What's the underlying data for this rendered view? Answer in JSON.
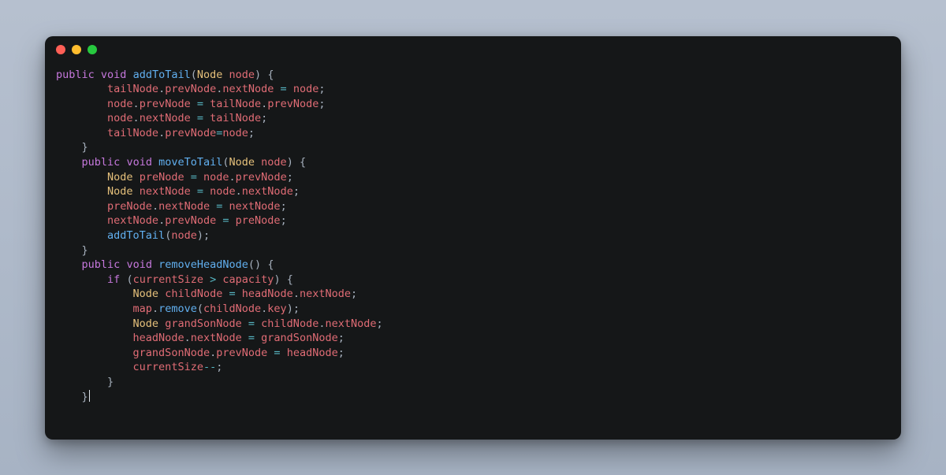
{
  "window": {
    "traffic_lights": [
      "close",
      "minimize",
      "maximize"
    ]
  },
  "code": {
    "language": "java",
    "lines": [
      {
        "indent": 0,
        "tokens": [
          [
            "kw",
            "public"
          ],
          [
            "sp",
            " "
          ],
          [
            "kw",
            "void"
          ],
          [
            "sp",
            " "
          ],
          [
            "fn",
            "addToTail"
          ],
          [
            "punc",
            "("
          ],
          [
            "type",
            "Node"
          ],
          [
            "sp",
            " "
          ],
          [
            "id",
            "node"
          ],
          [
            "punc",
            ")"
          ],
          [
            "sp",
            " "
          ],
          [
            "punc",
            "{"
          ]
        ]
      },
      {
        "indent": 2,
        "tokens": [
          [
            "id",
            "tailNode"
          ],
          [
            "punc",
            "."
          ],
          [
            "id",
            "prevNode"
          ],
          [
            "punc",
            "."
          ],
          [
            "id",
            "nextNode"
          ],
          [
            "sp",
            " "
          ],
          [
            "op",
            "="
          ],
          [
            "sp",
            " "
          ],
          [
            "id",
            "node"
          ],
          [
            "punc",
            ";"
          ]
        ]
      },
      {
        "indent": 2,
        "tokens": [
          [
            "id",
            "node"
          ],
          [
            "punc",
            "."
          ],
          [
            "id",
            "prevNode"
          ],
          [
            "sp",
            " "
          ],
          [
            "op",
            "="
          ],
          [
            "sp",
            " "
          ],
          [
            "id",
            "tailNode"
          ],
          [
            "punc",
            "."
          ],
          [
            "id",
            "prevNode"
          ],
          [
            "punc",
            ";"
          ]
        ]
      },
      {
        "indent": 2,
        "tokens": [
          [
            "id",
            "node"
          ],
          [
            "punc",
            "."
          ],
          [
            "id",
            "nextNode"
          ],
          [
            "sp",
            " "
          ],
          [
            "op",
            "="
          ],
          [
            "sp",
            " "
          ],
          [
            "id",
            "tailNode"
          ],
          [
            "punc",
            ";"
          ]
        ]
      },
      {
        "indent": 2,
        "tokens": [
          [
            "id",
            "tailNode"
          ],
          [
            "punc",
            "."
          ],
          [
            "id",
            "prevNode"
          ],
          [
            "op",
            "="
          ],
          [
            "id",
            "node"
          ],
          [
            "punc",
            ";"
          ]
        ]
      },
      {
        "indent": 1,
        "tokens": [
          [
            "punc",
            "}"
          ]
        ]
      },
      {
        "indent": 1,
        "tokens": [
          [
            "kw",
            "public"
          ],
          [
            "sp",
            " "
          ],
          [
            "kw",
            "void"
          ],
          [
            "sp",
            " "
          ],
          [
            "fn",
            "moveToTail"
          ],
          [
            "punc",
            "("
          ],
          [
            "type",
            "Node"
          ],
          [
            "sp",
            " "
          ],
          [
            "id",
            "node"
          ],
          [
            "punc",
            ")"
          ],
          [
            "sp",
            " "
          ],
          [
            "punc",
            "{"
          ]
        ]
      },
      {
        "indent": 2,
        "tokens": [
          [
            "type",
            "Node"
          ],
          [
            "sp",
            " "
          ],
          [
            "id",
            "preNode"
          ],
          [
            "sp",
            " "
          ],
          [
            "op",
            "="
          ],
          [
            "sp",
            " "
          ],
          [
            "id",
            "node"
          ],
          [
            "punc",
            "."
          ],
          [
            "id",
            "prevNode"
          ],
          [
            "punc",
            ";"
          ]
        ]
      },
      {
        "indent": 2,
        "tokens": [
          [
            "type",
            "Node"
          ],
          [
            "sp",
            " "
          ],
          [
            "id",
            "nextNode"
          ],
          [
            "sp",
            " "
          ],
          [
            "op",
            "="
          ],
          [
            "sp",
            " "
          ],
          [
            "id",
            "node"
          ],
          [
            "punc",
            "."
          ],
          [
            "id",
            "nextNode"
          ],
          [
            "punc",
            ";"
          ]
        ]
      },
      {
        "indent": 2,
        "tokens": [
          [
            "id",
            "preNode"
          ],
          [
            "punc",
            "."
          ],
          [
            "id",
            "nextNode"
          ],
          [
            "sp",
            " "
          ],
          [
            "op",
            "="
          ],
          [
            "sp",
            " "
          ],
          [
            "id",
            "nextNode"
          ],
          [
            "punc",
            ";"
          ]
        ]
      },
      {
        "indent": 2,
        "tokens": [
          [
            "id",
            "nextNode"
          ],
          [
            "punc",
            "."
          ],
          [
            "id",
            "prevNode"
          ],
          [
            "sp",
            " "
          ],
          [
            "op",
            "="
          ],
          [
            "sp",
            " "
          ],
          [
            "id",
            "preNode"
          ],
          [
            "punc",
            ";"
          ]
        ]
      },
      {
        "indent": 2,
        "tokens": [
          [
            "fn",
            "addToTail"
          ],
          [
            "punc",
            "("
          ],
          [
            "id",
            "node"
          ],
          [
            "punc",
            ")"
          ],
          [
            "punc",
            ";"
          ]
        ]
      },
      {
        "indent": 1,
        "tokens": [
          [
            "punc",
            "}"
          ]
        ]
      },
      {
        "indent": 1,
        "tokens": [
          [
            "kw",
            "public"
          ],
          [
            "sp",
            " "
          ],
          [
            "kw",
            "void"
          ],
          [
            "sp",
            " "
          ],
          [
            "fn",
            "removeHeadNode"
          ],
          [
            "punc",
            "("
          ],
          [
            "punc",
            ")"
          ],
          [
            "sp",
            " "
          ],
          [
            "punc",
            "{"
          ]
        ]
      },
      {
        "indent": 2,
        "tokens": [
          [
            "kw",
            "if"
          ],
          [
            "sp",
            " "
          ],
          [
            "punc",
            "("
          ],
          [
            "id",
            "currentSize"
          ],
          [
            "sp",
            " "
          ],
          [
            "op",
            ">"
          ],
          [
            "sp",
            " "
          ],
          [
            "id",
            "capacity"
          ],
          [
            "punc",
            ")"
          ],
          [
            "sp",
            " "
          ],
          [
            "punc",
            "{"
          ]
        ]
      },
      {
        "indent": 3,
        "tokens": [
          [
            "type",
            "Node"
          ],
          [
            "sp",
            " "
          ],
          [
            "id",
            "childNode"
          ],
          [
            "sp",
            " "
          ],
          [
            "op",
            "="
          ],
          [
            "sp",
            " "
          ],
          [
            "id",
            "headNode"
          ],
          [
            "punc",
            "."
          ],
          [
            "id",
            "nextNode"
          ],
          [
            "punc",
            ";"
          ]
        ]
      },
      {
        "indent": 3,
        "tokens": [
          [
            "id",
            "map"
          ],
          [
            "punc",
            "."
          ],
          [
            "fn",
            "remove"
          ],
          [
            "punc",
            "("
          ],
          [
            "id",
            "childNode"
          ],
          [
            "punc",
            "."
          ],
          [
            "id",
            "key"
          ],
          [
            "punc",
            ")"
          ],
          [
            "punc",
            ";"
          ]
        ]
      },
      {
        "indent": 3,
        "tokens": [
          [
            "type",
            "Node"
          ],
          [
            "sp",
            " "
          ],
          [
            "id",
            "grandSonNode"
          ],
          [
            "sp",
            " "
          ],
          [
            "op",
            "="
          ],
          [
            "sp",
            " "
          ],
          [
            "id",
            "childNode"
          ],
          [
            "punc",
            "."
          ],
          [
            "id",
            "nextNode"
          ],
          [
            "punc",
            ";"
          ]
        ]
      },
      {
        "indent": 3,
        "tokens": [
          [
            "id",
            "headNode"
          ],
          [
            "punc",
            "."
          ],
          [
            "id",
            "nextNode"
          ],
          [
            "sp",
            " "
          ],
          [
            "op",
            "="
          ],
          [
            "sp",
            " "
          ],
          [
            "id",
            "grandSonNode"
          ],
          [
            "punc",
            ";"
          ]
        ]
      },
      {
        "indent": 3,
        "tokens": [
          [
            "id",
            "grandSonNode"
          ],
          [
            "punc",
            "."
          ],
          [
            "id",
            "prevNode"
          ],
          [
            "sp",
            " "
          ],
          [
            "op",
            "="
          ],
          [
            "sp",
            " "
          ],
          [
            "id",
            "headNode"
          ],
          [
            "punc",
            ";"
          ]
        ]
      },
      {
        "indent": 3,
        "tokens": [
          [
            "id",
            "currentSize"
          ],
          [
            "op",
            "--"
          ],
          [
            "punc",
            ";"
          ]
        ]
      },
      {
        "indent": 2,
        "tokens": [
          [
            "punc",
            "}"
          ]
        ]
      },
      {
        "indent": 1,
        "tokens": [
          [
            "punc",
            "}"
          ]
        ],
        "cursor_after": true
      }
    ],
    "indent_unit": "    "
  }
}
